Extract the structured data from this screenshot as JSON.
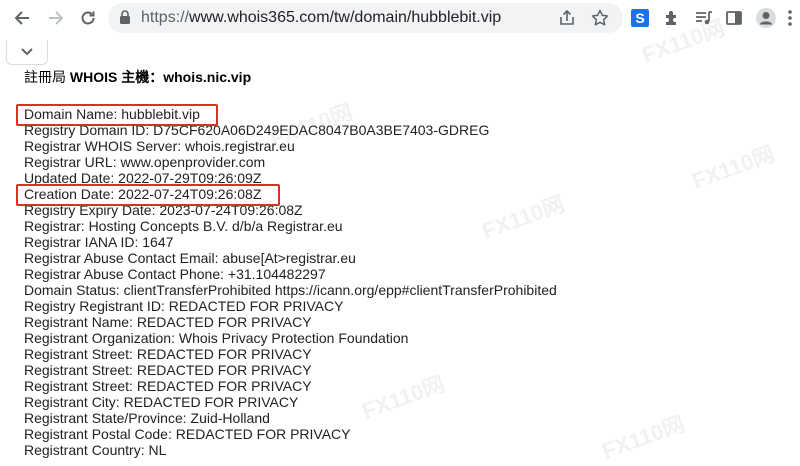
{
  "browser": {
    "url_scheme": "https://",
    "url_rest": "www.whois365.com/tw/domain/hubblebit.vip"
  },
  "page": {
    "heading_prefix": "註冊局 ",
    "heading_bold": "WHOIS 主機：whois.nic.vip",
    "lines": [
      "Domain Name: hubblebit.vip",
      "Registry Domain ID: D75CF620A06D249EDAC8047B0A3BE7403-GDREG",
      "Registrar WHOIS Server: whois.registrar.eu",
      "Registrar URL: www.openprovider.com",
      "Updated Date: 2022-07-29T09:26:09Z",
      "Creation Date: 2022-07-24T09:26:08Z",
      "Registry Expiry Date: 2023-07-24T09:26:08Z",
      "Registrar: Hosting Concepts B.V. d/b/a Registrar.eu",
      "Registrar IANA ID: 1647",
      "Registrar Abuse Contact Email: abuse[At>registrar.eu",
      "Registrar Abuse Contact Phone: +31.104482297",
      "Domain Status: clientTransferProhibited https://icann.org/epp#clientTransferProhibited",
      "Registry Registrant ID: REDACTED FOR PRIVACY",
      "Registrant Name: REDACTED FOR PRIVACY",
      "Registrant Organization: Whois Privacy Protection Foundation",
      "Registrant Street: REDACTED FOR PRIVACY",
      "Registrant Street: REDACTED FOR PRIVACY",
      "Registrant Street: REDACTED FOR PRIVACY",
      "Registrant City: REDACTED FOR PRIVACY",
      "Registrant State/Province: Zuid-Holland",
      "Registrant Postal Code: REDACTED FOR PRIVACY",
      "Registrant Country: NL"
    ]
  },
  "colors": {
    "highlight": "#d93025"
  },
  "watermark": "FX110网"
}
